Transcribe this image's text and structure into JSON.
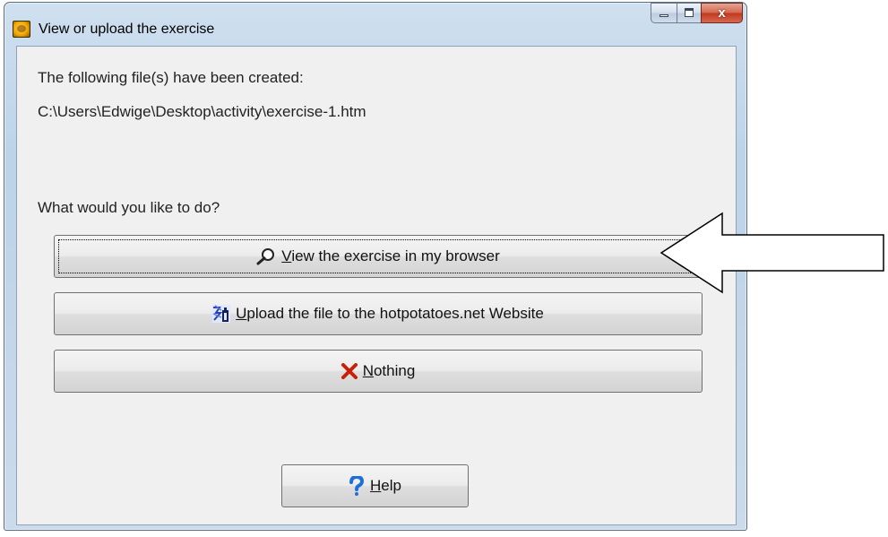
{
  "window": {
    "title": "View or upload the exercise",
    "controls": {
      "minimize": "minimize",
      "maximize": "maximize",
      "close": "x"
    }
  },
  "content": {
    "created_label": "The following file(s) have been created:",
    "file_path": "C:\\Users\\Edwige\\Desktop\\activity\\exercise-1.htm",
    "question": "What would you like to do?"
  },
  "buttons": {
    "view": {
      "accel": "V",
      "rest": "iew the exercise in my browser",
      "icon": "magnifier-icon"
    },
    "upload": {
      "accel": "U",
      "rest": "pload the file to the hotpotatoes.net Website",
      "icon": "hotpotatoes-net-icon"
    },
    "nothing": {
      "accel": "N",
      "rest": "othing",
      "icon": "red-x-icon"
    },
    "help": {
      "accel": "H",
      "rest": "elp",
      "icon": "question-mark-icon"
    }
  },
  "colors": {
    "red_x": "#c8200b",
    "help_blue": "#1e6fd6",
    "window_frame": "#bcd3e8",
    "client_bg": "#f0f0f0"
  }
}
